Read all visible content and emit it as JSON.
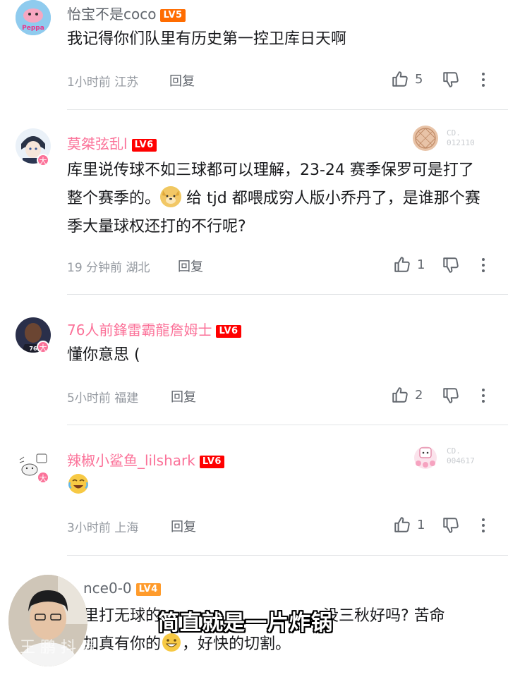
{
  "comments": [
    {
      "username": "怡宝不是coco",
      "level": "LV5",
      "text": "我记得你们队里有历史第一控卫库日天啊",
      "time": "1小时前",
      "location": "江苏",
      "reply_label": "回复",
      "likes": "5"
    },
    {
      "username": "莫桀弦乱l",
      "level": "LV6",
      "avatar_badge": "大",
      "fan_card_no_label": "CD.",
      "fan_card_no": "012110",
      "text_parts": [
        "库里说传球不如三球都可以理解，23-24 赛季保罗可是打了整个赛季的。",
        " 给 tjd 都喂成穷人版小乔丹了，是谁那个赛季大量球权还打的不行呢?"
      ],
      "time": "19 分钟前",
      "location": "湖北",
      "reply_label": "回复",
      "likes": "1"
    },
    {
      "username": "76人前鋒雷霸龍詹姆士",
      "level": "LV6",
      "avatar_badge": "大",
      "text": "懂你意思 (",
      "time": "5小时前",
      "location": "福建",
      "reply_label": "回复",
      "likes": "2"
    },
    {
      "username": "辣椒小鲨鱼_lilshark",
      "level": "LV6",
      "avatar_badge": "大",
      "fan_card_no_label": "CD.",
      "fan_card_no": "004617",
      "time": "3小时前",
      "location": "上海",
      "reply_label": "回复",
      "likes": "1"
    },
    {
      "username": "nce0-0",
      "level": "LV4",
      "text_line1": "里打无球的",
      "text_line1_tail": "没三秋好吗? 苦命",
      "text_line2_a": "加真有你的",
      "text_line2_b": "，好快的切割。"
    }
  ],
  "overlay": {
    "subtitle": "简直就是一片炸锅",
    "watermark": "王 鹏 抖 音"
  },
  "colors": {
    "pink_name": "#fb7299",
    "gray_name": "#61666d",
    "meta": "#9499a0",
    "divider": "#e3e5e7"
  }
}
